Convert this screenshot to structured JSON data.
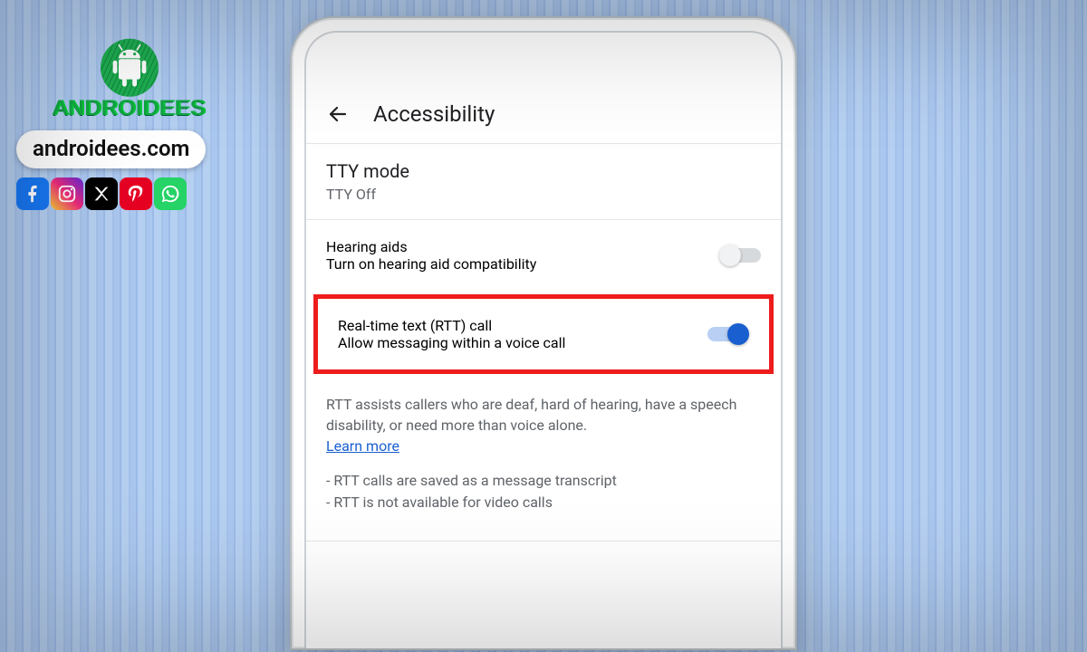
{
  "overlay": {
    "brand_wordmark": "ANDROIDEES",
    "site_label": "androidees.com",
    "socials": [
      "facebook",
      "instagram",
      "x",
      "pinterest",
      "whatsapp"
    ]
  },
  "screen": {
    "header_title": "Accessibility",
    "tty": {
      "title": "TTY mode",
      "subtitle": "TTY Off"
    },
    "hearing": {
      "title": "Hearing aids",
      "subtitle": "Turn on hearing aid compatibility",
      "toggle_on": false
    },
    "rtt": {
      "title": "Real-time text (RTT) call",
      "subtitle": "Allow messaging within a voice call",
      "toggle_on": true,
      "highlight_color": "#ee1c1c"
    },
    "info_text": "RTT assists callers who are deaf, hard of hearing, have a speech disability, or need more than voice alone.",
    "learn_more": "Learn more",
    "note1": "- RTT calls are saved as a message transcript",
    "note2": "- RTT is not available for video calls"
  },
  "colors": {
    "accent": "#1a5fd0"
  }
}
